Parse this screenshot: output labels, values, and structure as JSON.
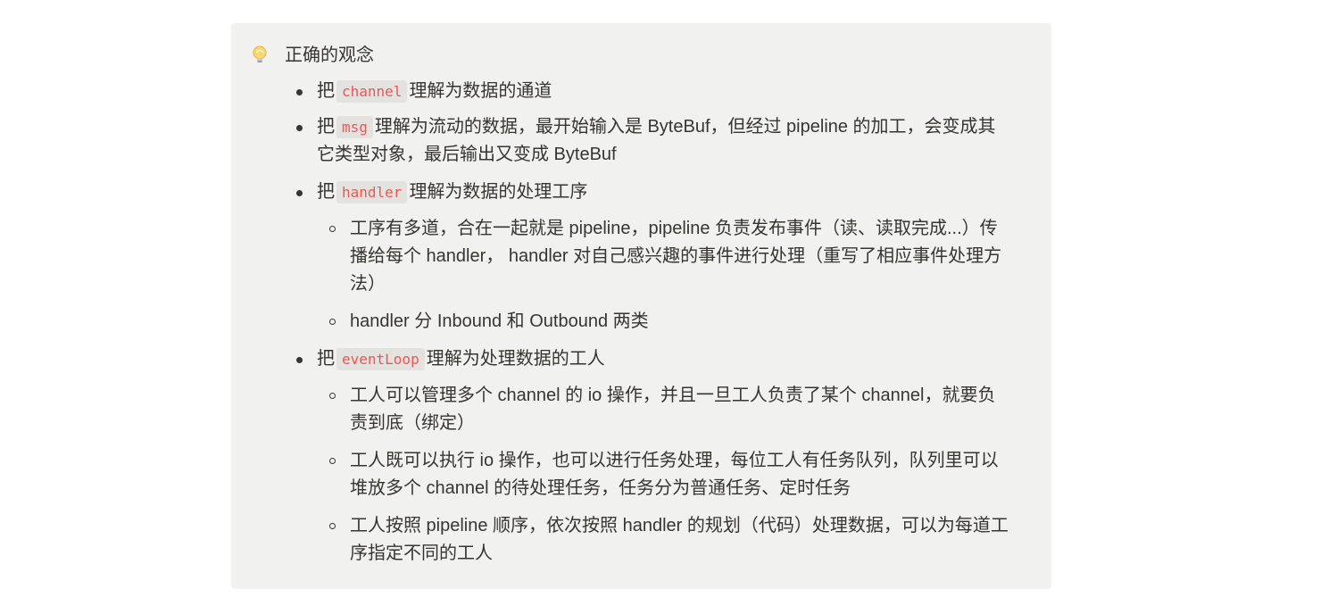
{
  "callout": {
    "icon": "lightbulb-icon",
    "title": "正确的观念"
  },
  "items": [
    {
      "prefix": "把",
      "code": "channel",
      "text": "理解为数据的通道"
    },
    {
      "prefix": "把",
      "code": "msg",
      "text": "理解为流动的数据，最开始输入是 ByteBuf，但经过 pipeline 的加工，会变成其",
      "text2": "它类型对象，最后输出又变成 ByteBuf"
    },
    {
      "prefix": "把",
      "code": "handler",
      "text": "理解为数据的处理工序"
    },
    {
      "sub1": "工序有多道，合在一起就是 pipeline，pipeline 负责发布事件（读、读取完成...）传",
      "sub1b": "播给每个 handler， handler 对自己感兴趣的事件进行处理（重写了相应事件处理方",
      "sub1c": "法）"
    },
    {
      "sub2": "handler 分 Inbound 和 Outbound 两类"
    },
    {
      "prefix": "把",
      "code": "eventLoop",
      "text": "理解为处理数据的工人"
    },
    {
      "sub1": "工人可以管理多个 channel 的 io 操作，并且一旦工人负责了某个 channel，就要负",
      "sub1b": "责到底（绑定）"
    },
    {
      "sub1": "工人既可以执行 io 操作，也可以进行任务处理，每位工人有任务队列，队列里可以",
      "sub1b": "堆放多个 channel 的待处理任务，任务分为普通任务、定时任务"
    },
    {
      "sub1": "工人按照 pipeline 顺序，依次按照 handler 的规划（代码）处理数据，可以为每道工",
      "sub1b": "序指定不同的工人"
    }
  ]
}
